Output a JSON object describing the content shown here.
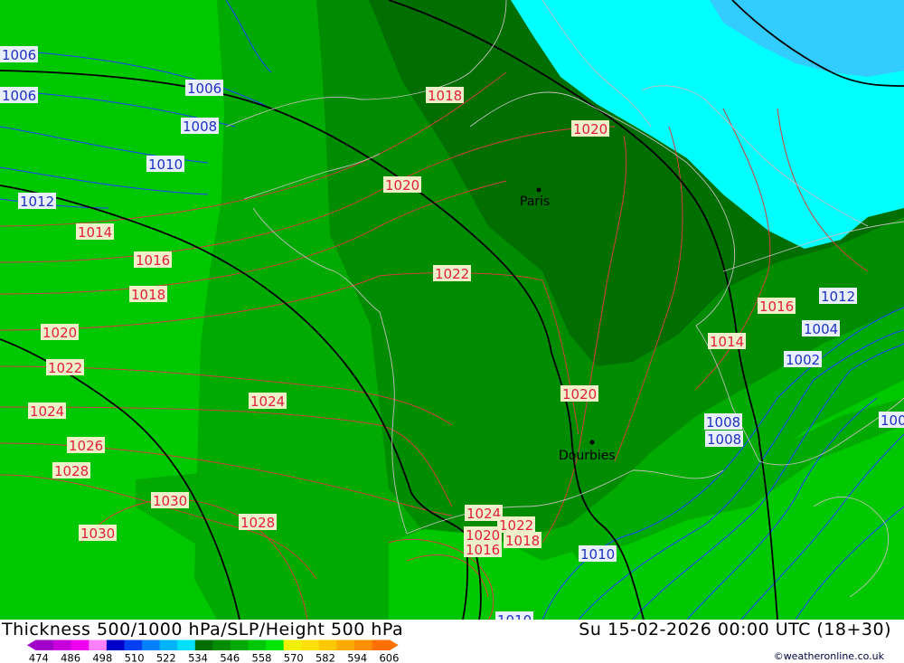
{
  "map": {
    "cities": [
      {
        "name": "Paris"
      },
      {
        "name": "Dourbies"
      }
    ],
    "slp_labels": [
      {
        "value": "1006",
        "kind": "blue"
      },
      {
        "value": "1006",
        "kind": "blue"
      },
      {
        "value": "1008",
        "kind": "blue"
      },
      {
        "value": "1008",
        "kind": "blue"
      },
      {
        "value": "1010",
        "kind": "blue"
      },
      {
        "value": "1012",
        "kind": "blue"
      },
      {
        "value": "1014",
        "kind": "red"
      },
      {
        "value": "1016",
        "kind": "red"
      },
      {
        "value": "1018",
        "kind": "red"
      },
      {
        "value": "1020",
        "kind": "red"
      },
      {
        "value": "1022",
        "kind": "red"
      },
      {
        "value": "1024",
        "kind": "red"
      },
      {
        "value": "1026",
        "kind": "red"
      },
      {
        "value": "1028",
        "kind": "red"
      },
      {
        "value": "1030",
        "kind": "red"
      },
      {
        "value": "1024",
        "kind": "red"
      },
      {
        "value": "1030",
        "kind": "red"
      },
      {
        "value": "1028",
        "kind": "red"
      },
      {
        "value": "1018",
        "kind": "red"
      },
      {
        "value": "1020",
        "kind": "red"
      },
      {
        "value": "1020",
        "kind": "red"
      },
      {
        "value": "1022",
        "kind": "red"
      },
      {
        "value": "1020",
        "kind": "red"
      },
      {
        "value": "1016",
        "kind": "red"
      },
      {
        "value": "1014",
        "kind": "red"
      },
      {
        "value": "1012",
        "kind": "blue"
      },
      {
        "value": "1004",
        "kind": "blue"
      },
      {
        "value": "1002",
        "kind": "blue"
      },
      {
        "value": "1010",
        "kind": "blue"
      },
      {
        "value": "1008",
        "kind": "blue"
      },
      {
        "value": "1006",
        "kind": "blue"
      },
      {
        "value": "1024",
        "kind": "red"
      },
      {
        "value": "1022",
        "kind": "red"
      },
      {
        "value": "1020",
        "kind": "red"
      },
      {
        "value": "1018",
        "kind": "red"
      },
      {
        "value": "1016",
        "kind": "red"
      },
      {
        "value": "1010",
        "kind": "blue"
      },
      {
        "value": "100",
        "kind": "blue"
      }
    ],
    "colors": {
      "thickness_bright": "#00c800",
      "thickness_mid": "#00aa00",
      "thickness_dark": "#008c00",
      "thickness_darkest": "#006e00",
      "cyan_area": "#00ffff",
      "light_blue_area": "#33ccff",
      "slp_high_contour": "#d04040",
      "slp_low_contour": "#2040ff",
      "height_500_contour": "#000000",
      "borders": "#c0c0c0"
    }
  },
  "footer": {
    "title": "Thickness 500/1000 hPa/SLP/Height 500 hPa",
    "datetime": "Su 15-02-2026 00:00 UTC (18+30)",
    "scale_values": [
      "474",
      "486",
      "498",
      "510",
      "522",
      "534",
      "546",
      "558",
      "570",
      "582",
      "594",
      "606"
    ],
    "scale_colors": [
      "#a000c8",
      "#c800dc",
      "#f000f0",
      "#ff80ff",
      "#0000c8",
      "#0040f0",
      "#0080ff",
      "#00b4ff",
      "#00e0ff",
      "#006e00",
      "#008c00",
      "#00aa00",
      "#00c800",
      "#00e600",
      "#f0f000",
      "#ffe000",
      "#ffc800",
      "#ffaa00",
      "#ff9000",
      "#ff7000"
    ],
    "credit": "©weatheronline.co.uk"
  }
}
